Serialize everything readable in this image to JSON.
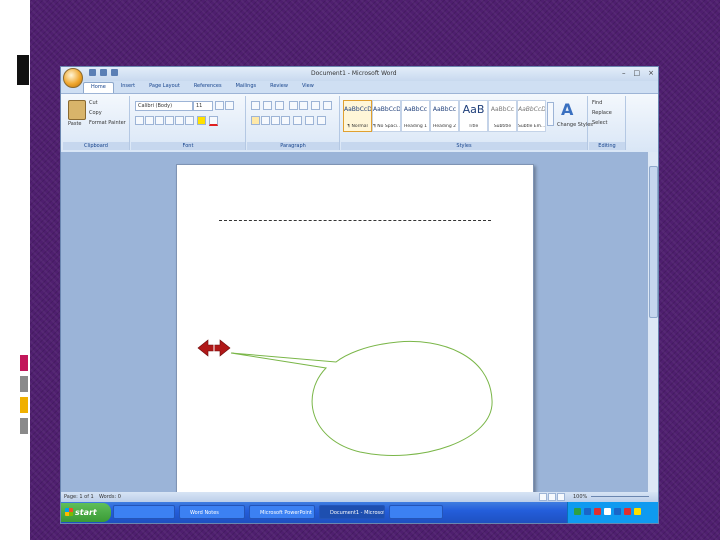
{
  "window": {
    "title": "Document1 - Microsoft Word",
    "controls": [
      "–",
      "□",
      "×"
    ]
  },
  "ribbon": {
    "tabs": [
      "Home",
      "Insert",
      "Page Layout",
      "References",
      "Mailings",
      "Review",
      "View"
    ],
    "active_tab": "Home",
    "clipboard": {
      "paste": "Paste",
      "cut": "Cut",
      "copy": "Copy",
      "format_painter": "Format Painter",
      "label": "Clipboard"
    },
    "font": {
      "name": "Calibri (Body)",
      "size": "11",
      "label": "Font"
    },
    "paragraph": {
      "label": "Paragraph"
    },
    "styles": {
      "items": [
        {
          "sample": "AaBbCcDc",
          "name": "¶ Normal"
        },
        {
          "sample": "AaBbCcDc",
          "name": "¶ No Spaci..."
        },
        {
          "sample": "AaBbCc",
          "name": "Heading 1"
        },
        {
          "sample": "AaBbCc",
          "name": "Heading 2"
        },
        {
          "sample": "AaB",
          "name": "Title"
        },
        {
          "sample": "AaBbCc",
          "name": "Subtitle"
        },
        {
          "sample": "AaBbCcDc",
          "name": "Subtle Em..."
        }
      ],
      "change_styles": "Change Styles",
      "label": "Styles"
    },
    "editing": {
      "find": "Find",
      "replace": "Replace",
      "select": "Select",
      "label": "Editing"
    }
  },
  "status": {
    "page": "Page: 1 of 1",
    "words": "Words: 0",
    "zoom": "100%"
  },
  "taskbar": {
    "start": "start",
    "items": [
      "",
      "Word Notes",
      "Microsoft PowerPoint",
      "Document1 - Microsoft...",
      ""
    ],
    "active_index": 3
  },
  "colors": {
    "slide_bg": "#4f1f6f",
    "callout_stroke": "#7ab648",
    "arrow_red": "#b01818"
  }
}
